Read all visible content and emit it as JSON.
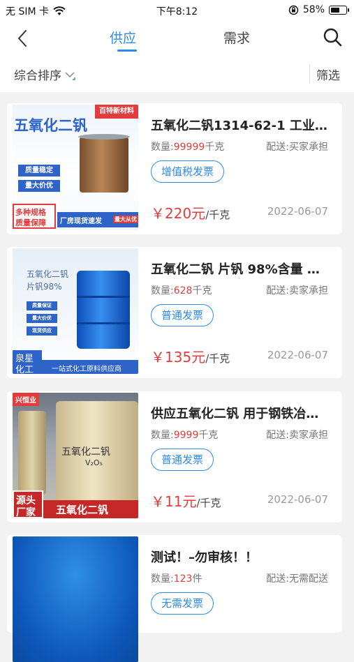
{
  "status_bar": {
    "carrier": "无 SIM 卡",
    "time": "下午8:12",
    "battery": "58%",
    "battery_level": 0.58
  },
  "nav": {
    "tabs": [
      {
        "label": "供应",
        "active": true
      },
      {
        "label": "需求",
        "active": false
      }
    ]
  },
  "filter_bar": {
    "sort_label": "综合排序",
    "filter_label": "筛选"
  },
  "products": [
    {
      "title": "五氧化二钒1314-62-1 工业…",
      "qty_label": "数量:",
      "qty_value": "99999",
      "qty_unit": "千克",
      "delivery": "配送:买家承担",
      "invoice": "增值税发票",
      "price": "￥220元",
      "price_unit": "/千克",
      "date": "2022-06-07",
      "image": {
        "heading": "五氧化二钒",
        "badge": "百特新材料",
        "tags": [
          "质量稳定",
          "量大价优"
        ],
        "promo": [
          "多种规格",
          "质量保障"
        ],
        "footer": "厂房现货速发",
        "footer_badge": "量大从优"
      }
    },
    {
      "title": "五氧化二钒 片钒 98%含量 …",
      "qty_label": "数量:",
      "qty_value": "628",
      "qty_unit": "千克",
      "delivery": "配送:卖家承担",
      "invoice": "普通发票",
      "price": "￥135元",
      "price_unit": "/千克",
      "date": "2022-06-07",
      "image": {
        "heading_lines": [
          "五氧化二钒",
          "片钒98%"
        ],
        "tags": [
          "质量保证",
          "量大价优",
          "现货供应"
        ],
        "brand": [
          "泉星",
          "化工"
        ],
        "footer": "一站式化工原料供应商"
      }
    },
    {
      "title": "供应五氧化二钒 用于钢铁冶…",
      "qty_label": "数量:",
      "qty_value": "9999",
      "qty_unit": "千克",
      "delivery": "配送:卖家承担",
      "invoice": "普通发票",
      "price": "￥11元",
      "price_unit": "/千克",
      "date": "2022-06-07",
      "image": {
        "badge": "兴恒业",
        "barrel_label": "五氧化二钒",
        "formula": "V₂O₅",
        "brand": [
          "源头",
          "厂家"
        ],
        "footer": "五氧化二钒"
      }
    },
    {
      "title": "测试！–勿审核！！",
      "qty_label": "数量:",
      "qty_value": "123",
      "qty_unit": "件",
      "delivery": "配送:无需配送",
      "invoice": "无需发票",
      "price": "",
      "price_unit": "",
      "date": "",
      "image": {}
    }
  ],
  "colors": {
    "accent": "#2e8be6",
    "price": "#e23c3c",
    "background": "#f2f2f2"
  }
}
